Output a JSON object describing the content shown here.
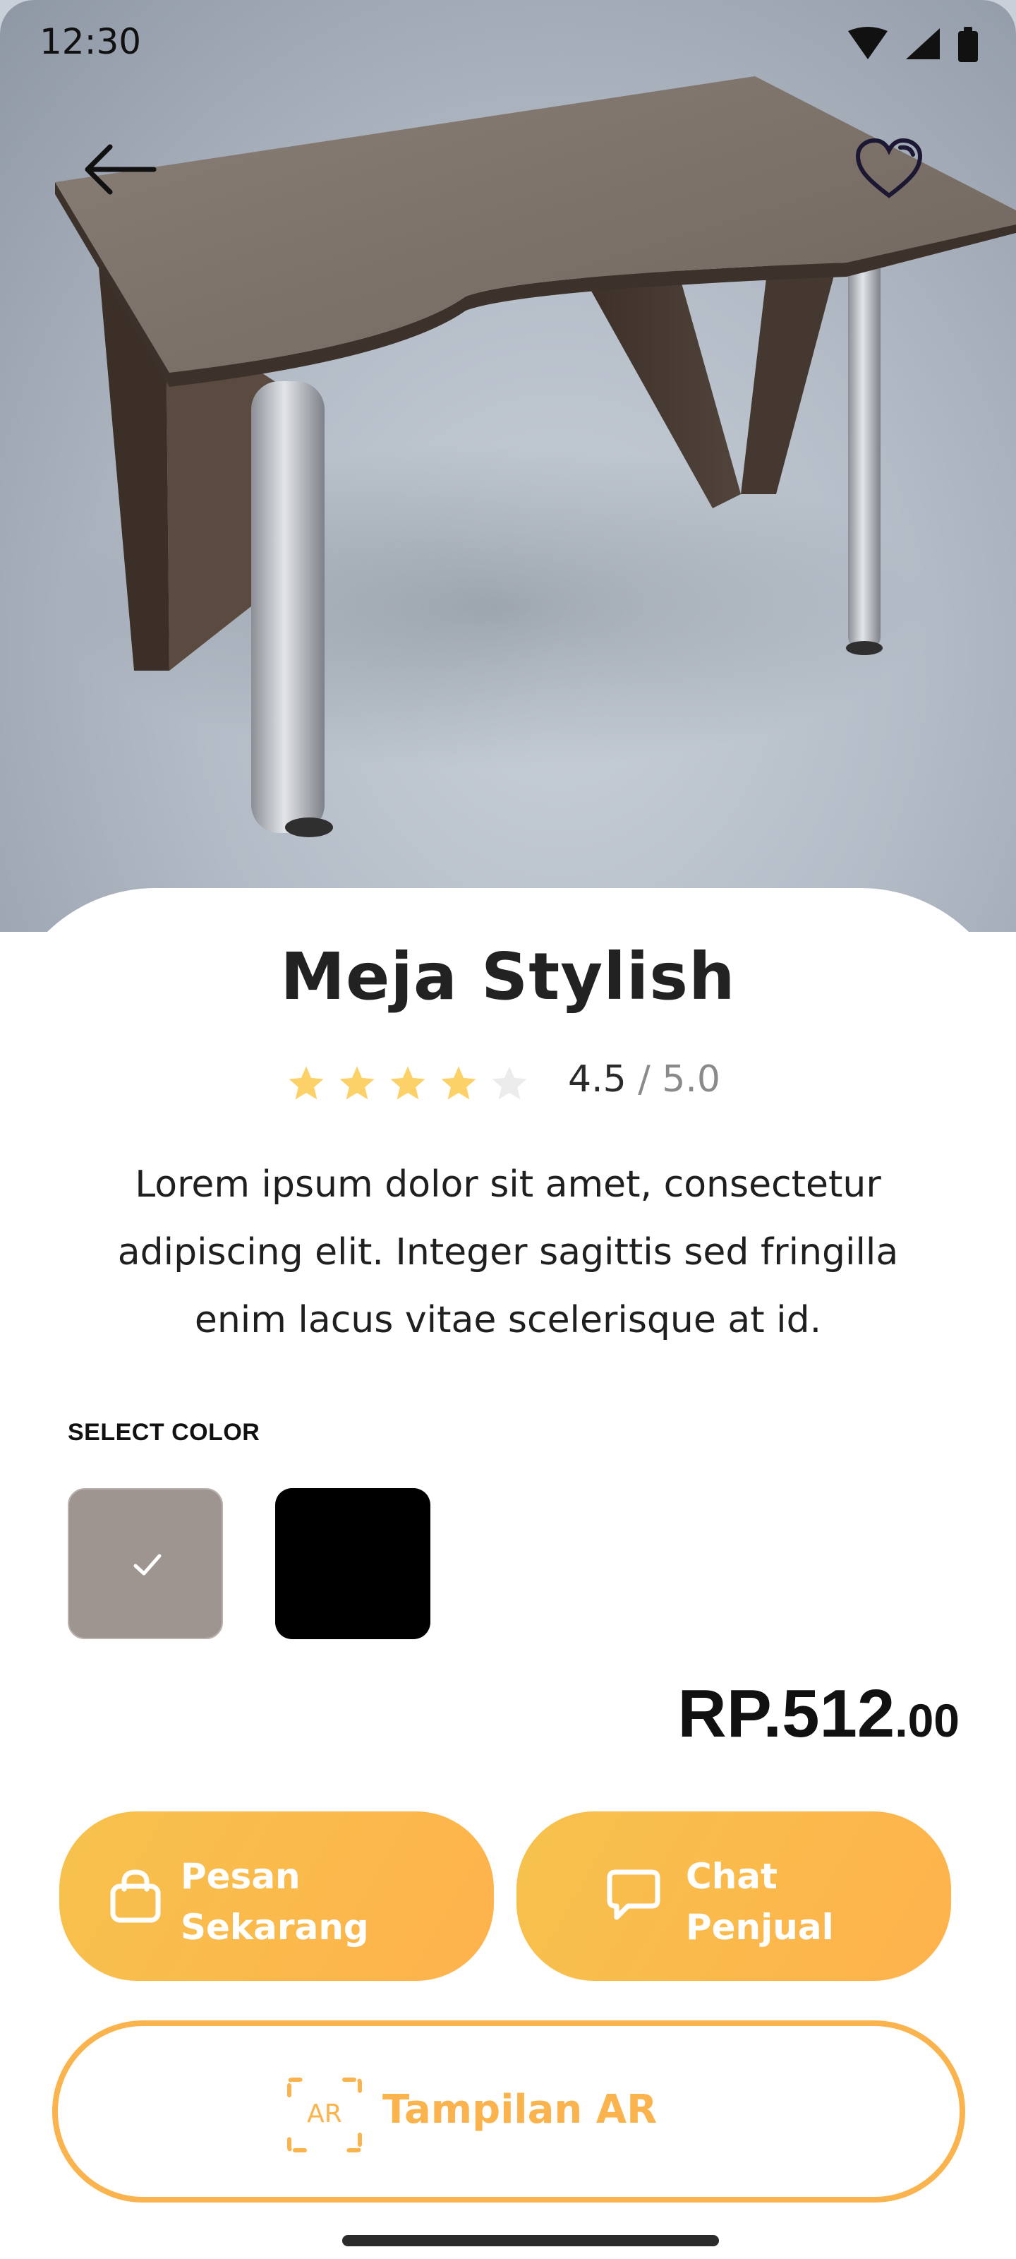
{
  "status_bar": {
    "time": "12:30"
  },
  "product": {
    "name": "Meja Stylish",
    "rating": {
      "value": "4.5",
      "separator": "/",
      "max": "5.0",
      "stars_filled": 4,
      "stars_total": 5
    },
    "description": "Lorem ipsum dolor sit amet, consectetur adipiscing elit. Integer sagittis sed fringilla enim lacus vitae scelerisque at id."
  },
  "colors": {
    "label": "SELECT COLOR",
    "options": [
      {
        "name": "taupe",
        "hex": "#9e9591",
        "selected": true
      },
      {
        "name": "black",
        "hex": "#000000",
        "selected": false
      }
    ]
  },
  "price": {
    "main": "RP.512",
    "cents": ".00"
  },
  "actions": {
    "order": {
      "line1": "Pesan",
      "line2": "Sekarang",
      "icon": "shopping-bag-icon"
    },
    "chat": {
      "line1": "Chat",
      "line2": "Penjual",
      "icon": "chat-bubble-icon"
    },
    "ar": {
      "label": "Tampilan AR",
      "icon_text": "AR"
    }
  },
  "theme": {
    "accent": "#fbb34d",
    "star": "#fcd168",
    "star_empty": "#ececec"
  }
}
